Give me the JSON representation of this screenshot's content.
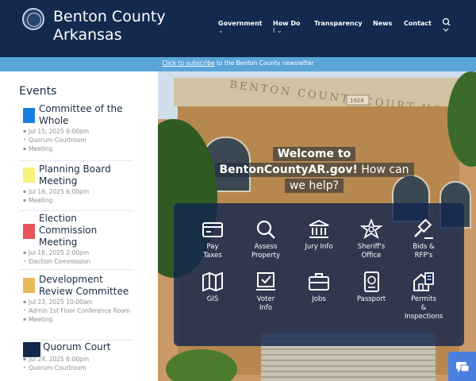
{
  "header": {
    "title_line1": "Benton County",
    "title_line2": "Arkansas",
    "nav": [
      {
        "label": "Government",
        "chevron": "⌄"
      },
      {
        "label": "How Do",
        "label2": "I",
        "chevron": "⌄"
      },
      {
        "label": "Transparency"
      },
      {
        "label": "News"
      },
      {
        "label": "Contact"
      }
    ],
    "search_icon": "search-icon"
  },
  "banner": {
    "link_text": "Click to subscribe",
    "rest_text": " to the Benton County newsletter",
    "color": "#5aa6d9"
  },
  "events": {
    "heading": "Events",
    "items": [
      {
        "title": "Committee of the Whole",
        "date": "Jul 15, 2025 6:00pm",
        "location": "Quorum Courtroom",
        "category": "Meeting",
        "color": "#1a7de0"
      },
      {
        "title": "Planning Board Meeting",
        "date": "Jul 16, 2025 6:00pm",
        "category": "Meeting",
        "color": "#f7f27a"
      },
      {
        "title": "Election Commission Meeting",
        "date": "Jul 18, 2025 2:00pm",
        "location": "Election Commission",
        "color": "#e8545a"
      },
      {
        "title": "Development Review Committee",
        "date": "Jul 23, 2025 10:00am",
        "location": "Admin 1st Floor Conference Room",
        "category": "Meeting",
        "color": "#e8b95a"
      },
      {
        "title": "Quorum Court",
        "date": "Jul 24, 2025 6:00pm",
        "location": "Quorum Courtroom",
        "color": "#14284a"
      }
    ]
  },
  "hero": {
    "welcome_bold1": "Welcome to",
    "welcome_bold2": "BentonCountyAR.gov!",
    "welcome_rest": " How can",
    "welcome_line3": "we help?",
    "building_text": "BENTON COUNTY COURT HOUSE",
    "year": "1928",
    "quick_links": [
      {
        "label": "Pay",
        "label2": "Taxes",
        "icon": "credit-card-icon"
      },
      {
        "label": "Assess",
        "label2": "Property",
        "icon": "magnifier-icon"
      },
      {
        "label": "Jury Info",
        "icon": "courthouse-icon"
      },
      {
        "label": "Sheriff's",
        "label2": "Office",
        "icon": "sheriff-star-icon"
      },
      {
        "label": "Bids &",
        "label2": "RFP's",
        "icon": "gavel-icon"
      },
      {
        "label": "GIS",
        "icon": "map-icon"
      },
      {
        "label": "Voter",
        "label2": "Info",
        "icon": "ballot-icon"
      },
      {
        "label": "Jobs",
        "icon": "briefcase-icon"
      },
      {
        "label": "Passport",
        "icon": "passport-icon"
      },
      {
        "label": "Permits",
        "label2": "&",
        "label3": "Inspections",
        "icon": "permits-icon"
      }
    ]
  },
  "chat": {
    "icon": "chat-icon"
  },
  "colors": {
    "header_bg": "#132a4e",
    "panel_bg": "#12264e",
    "accent": "#4a7fe0"
  }
}
